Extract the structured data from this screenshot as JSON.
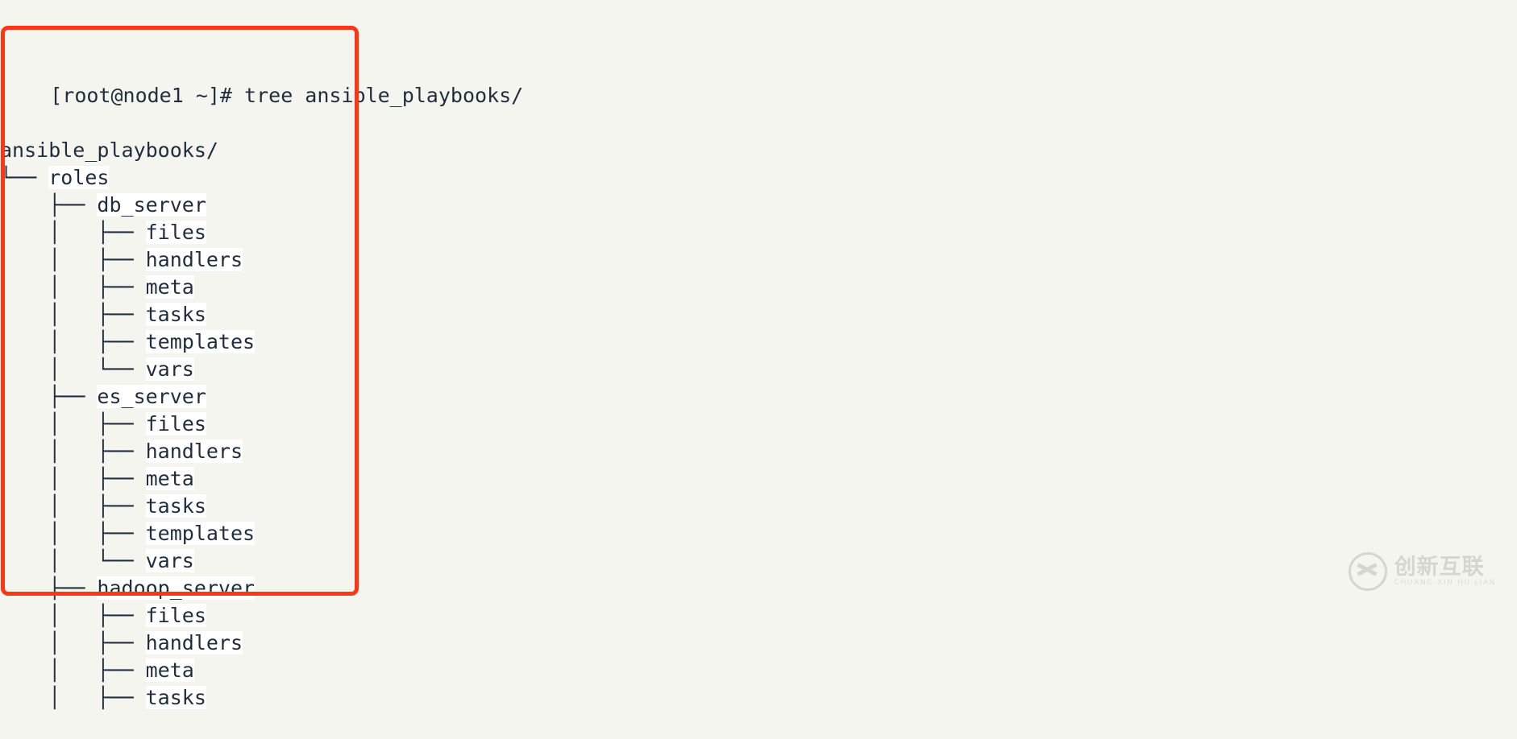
{
  "terminal": {
    "prompt": "[root@node1 ~]# ",
    "command": "tree ansible_playbooks/",
    "prompt_line": "[root@node1 ~]# tree ansible_playbooks/",
    "root_label": "ansible_playbooks/"
  },
  "tree_lines": [
    {
      "prefix": "",
      "name": "ansible_playbooks/",
      "highlight": false
    },
    {
      "prefix": "└── ",
      "name": "roles",
      "highlight": true
    },
    {
      "prefix": "    ├── ",
      "name": "db_server",
      "highlight": true
    },
    {
      "prefix": "    │   ├── ",
      "name": "files",
      "highlight": true
    },
    {
      "prefix": "    │   ├── ",
      "name": "handlers",
      "highlight": true
    },
    {
      "prefix": "    │   ├── ",
      "name": "meta",
      "highlight": true
    },
    {
      "prefix": "    │   ├── ",
      "name": "tasks",
      "highlight": true
    },
    {
      "prefix": "    │   ├── ",
      "name": "templates",
      "highlight": true
    },
    {
      "prefix": "    │   └── ",
      "name": "vars",
      "highlight": true
    },
    {
      "prefix": "    ├── ",
      "name": "es_server",
      "highlight": true
    },
    {
      "prefix": "    │   ├── ",
      "name": "files",
      "highlight": true
    },
    {
      "prefix": "    │   ├── ",
      "name": "handlers",
      "highlight": true
    },
    {
      "prefix": "    │   ├── ",
      "name": "meta",
      "highlight": true
    },
    {
      "prefix": "    │   ├── ",
      "name": "tasks",
      "highlight": true
    },
    {
      "prefix": "    │   ├── ",
      "name": "templates",
      "highlight": true
    },
    {
      "prefix": "    │   └── ",
      "name": "vars",
      "highlight": true
    },
    {
      "prefix": "    ├── ",
      "name": "hadoop_server",
      "highlight": true
    },
    {
      "prefix": "    │   ├── ",
      "name": "files",
      "highlight": true
    },
    {
      "prefix": "    │   ├── ",
      "name": "handlers",
      "highlight": true
    },
    {
      "prefix": "    │   ├── ",
      "name": "meta",
      "highlight": true
    },
    {
      "prefix": "    │   ├── ",
      "name": "tasks",
      "highlight": true
    }
  ],
  "annotation": {
    "color": "#ff3616",
    "shape": "rounded-rectangle"
  },
  "watermark": {
    "chinese": "创新互联",
    "pinyin": "CHUANG XIN HU LIAN",
    "logo": "cx-circle-logo",
    "color": "#8d8d8d"
  },
  "colors": {
    "background": "#f5f5f0",
    "text": "#1f2d3d",
    "dir_highlight": "#ffffff",
    "annotation": "#ff3616"
  }
}
